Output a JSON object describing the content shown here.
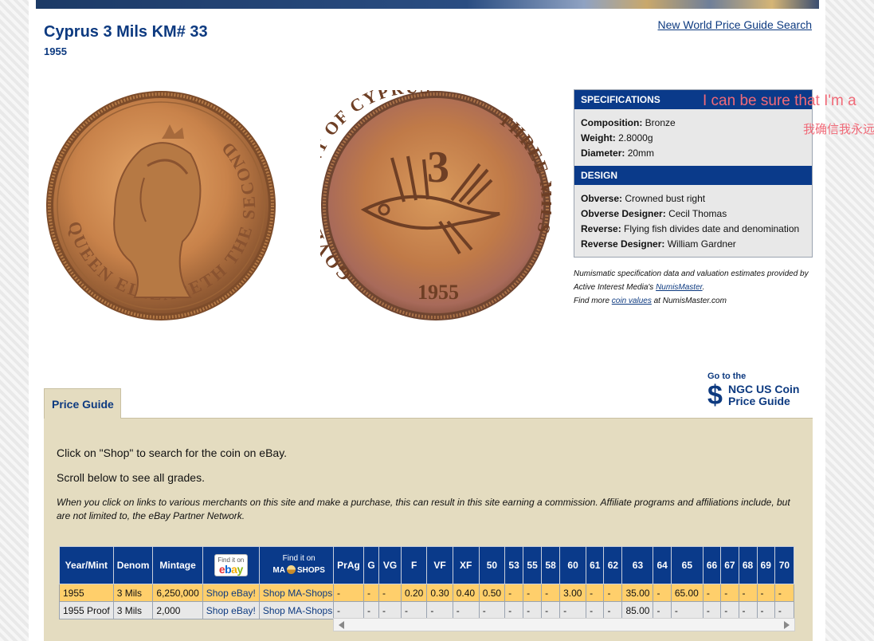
{
  "header": {
    "title": "Cyprus 3 Mils KM# 33",
    "subtitle": "1955",
    "search_link": "New World Price Guide Search"
  },
  "coins": {
    "obverse_legend": "QUEEN ELIZABETH THE SECOND",
    "reverse_legend": "GOVERNMENT OF CYPRUS",
    "reverse_legend_right": "THREE MILS",
    "reverse_numeral": "3",
    "reverse_date": "1955"
  },
  "specifications": {
    "heading": "SPECIFICATIONS",
    "composition_label": "Composition:",
    "composition": "Bronze",
    "weight_label": "Weight:",
    "weight": "2.8000g",
    "diameter_label": "Diameter:",
    "diameter": "20mm"
  },
  "design": {
    "heading": "DESIGN",
    "obverse_label": "Obverse:",
    "obverse": "Crowned bust right",
    "obverse_designer_label": "Obverse Designer:",
    "obverse_designer": "Cecil Thomas",
    "reverse_label": "Reverse:",
    "reverse": "Flying fish divides date and denomination",
    "reverse_designer_label": "Reverse Designer:",
    "reverse_designer": "William Gardner"
  },
  "attribution": {
    "line1": "Numismatic specification data and valuation estimates provided by",
    "line2_prefix": "Active Interest Media's",
    "line2_link": "NumisMaster",
    "line2_suffix": ".",
    "line3_prefix": "Find more",
    "line3_link": "coin values",
    "line3_suffix": "at NumisMaster.com"
  },
  "overlay": {
    "text1": "I can be sure that I'm a",
    "text2": "我确信我永远"
  },
  "ngc": {
    "goto": "Go to the",
    "dollar": "$",
    "line1": "NGC US Coin",
    "line2": "Price Guide"
  },
  "price_guide": {
    "tab_label": "Price Guide",
    "instruction1": "Click on \"Shop\" to search for the coin on eBay.",
    "instruction2": "Scroll below to see all grades.",
    "disclaimer": "When you click on links to various merchants on this site and make a purchase, this can result in this site earning a commission. Affiliate programs and affiliations include, but are not limited to, the eBay Partner Network."
  },
  "table": {
    "left_headers": {
      "year_mint": "Year/Mint",
      "denom": "Denom",
      "mintage": "Mintage",
      "ebay_top": "Find it on",
      "ma_top": "Find it on",
      "ma_left": "MA",
      "ma_right": "SHOPS",
      "currency": "$"
    },
    "grade_headers": [
      "PrAg",
      "G",
      "VG",
      "F",
      "VF",
      "XF",
      "50",
      "53",
      "55",
      "58",
      "60",
      "61",
      "62",
      "63",
      "64",
      "65",
      "66",
      "67",
      "68",
      "69",
      "70"
    ],
    "rows": [
      {
        "year_mint": "1955",
        "denom": "3 Mils",
        "mintage": "6,250,000",
        "ebay": "Shop eBay!",
        "ma": "Shop MA-Shops!",
        "currency": "$",
        "grades": [
          "-",
          "-",
          "-",
          "0.20",
          "0.30",
          "0.40",
          "0.50",
          "-",
          "-",
          "-",
          "3.00",
          "-",
          "-",
          "35.00",
          "-",
          "65.00",
          "-",
          "-",
          "-",
          "-",
          "-"
        ]
      },
      {
        "year_mint": "1955 Proof",
        "denom": "3 Mils",
        "mintage": "2,000",
        "ebay": "Shop eBay!",
        "ma": "Shop MA-Shops!",
        "currency": "$",
        "grades": [
          "-",
          "-",
          "-",
          "-",
          "-",
          "-",
          "-",
          "-",
          "-",
          "-",
          "-",
          "-",
          "-",
          "85.00",
          "-",
          "-",
          "-",
          "-",
          "-",
          "-",
          "-"
        ]
      }
    ]
  }
}
